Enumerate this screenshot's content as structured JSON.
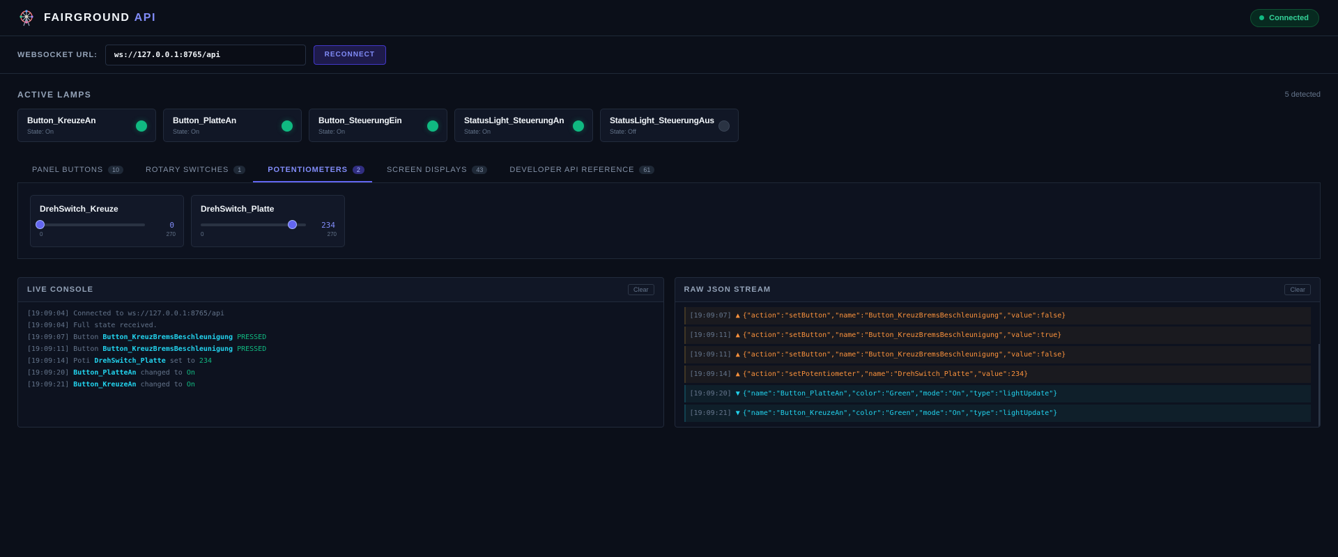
{
  "app": {
    "brand_main": "FAIRGROUND",
    "brand_accent": "API",
    "status": "Connected"
  },
  "connection": {
    "label": "WEBSOCKET URL:",
    "url": "ws://127.0.0.1:8765/api",
    "reconnect_label": "RECONNECT"
  },
  "lamps": {
    "title": "ACTIVE LAMPS",
    "detected": "5 detected",
    "items": [
      {
        "name": "Button_KreuzeAn",
        "state": "State: On",
        "on": true
      },
      {
        "name": "Button_PlatteAn",
        "state": "State: On",
        "on": true
      },
      {
        "name": "Button_SteuerungEin",
        "state": "State: On",
        "on": true
      },
      {
        "name": "StatusLight_SteuerungAn",
        "state": "State: On",
        "on": true
      },
      {
        "name": "StatusLight_SteuerungAus",
        "state": "State: Off",
        "on": false
      }
    ]
  },
  "tabs": [
    {
      "label": "PANEL BUTTONS",
      "count": "10",
      "active": false
    },
    {
      "label": "ROTARY SWITCHES",
      "count": "1",
      "active": false
    },
    {
      "label": "POTENTIOMETERS",
      "count": "2",
      "active": true
    },
    {
      "label": "SCREEN DISPLAYS",
      "count": "43",
      "active": false
    },
    {
      "label": "DEVELOPER API REFERENCE",
      "count": "61",
      "active": false
    }
  ],
  "potentiometers": [
    {
      "name": "DrehSwitch_Kreuze",
      "value": "0",
      "fraction": 0.0,
      "min": "0",
      "max": "270"
    },
    {
      "name": "DrehSwitch_Platte",
      "value": "234",
      "fraction": 0.8667,
      "min": "0",
      "max": "270"
    }
  ],
  "console": {
    "title": "LIVE CONSOLE",
    "clear_label": "Clear",
    "lines": [
      {
        "ts": "[19:09:04]",
        "pre": "Connected to ws://127.0.0.1:8765/api",
        "name": "",
        "mid": "",
        "kw": ""
      },
      {
        "ts": "[19:09:04]",
        "pre": "Full state received.",
        "name": "",
        "mid": "",
        "kw": ""
      },
      {
        "ts": "[19:09:07]",
        "pre": "Button",
        "name": "Button_KreuzBremsBeschleunigung",
        "mid": "",
        "kw": "PRESSED"
      },
      {
        "ts": "[19:09:11]",
        "pre": "Button",
        "name": "Button_KreuzBremsBeschleunigung",
        "mid": "",
        "kw": "PRESSED"
      },
      {
        "ts": "[19:09:14]",
        "pre": "Poti",
        "name": "DrehSwitch_Platte",
        "mid": "set to",
        "kw": "234"
      },
      {
        "ts": "[19:09:20]",
        "pre": "",
        "name": "Button_PlatteAn",
        "mid": "changed to",
        "kw": "On"
      },
      {
        "ts": "[19:09:21]",
        "pre": "",
        "name": "Button_KreuzeAn",
        "mid": "changed to",
        "kw": "On"
      }
    ]
  },
  "json_stream": {
    "title": "RAW JSON STREAM",
    "clear_label": "Clear",
    "entries": [
      {
        "ts": "[19:09:07]",
        "dir": "out",
        "arrow": "▲",
        "text": "{\"action\":\"setButton\",\"name\":\"Button_KreuzBremsBeschleunigung\",\"value\":false}"
      },
      {
        "ts": "[19:09:11]",
        "dir": "out",
        "arrow": "▲",
        "text": "{\"action\":\"setButton\",\"name\":\"Button_KreuzBremsBeschleunigung\",\"value\":true}"
      },
      {
        "ts": "[19:09:11]",
        "dir": "out",
        "arrow": "▲",
        "text": "{\"action\":\"setButton\",\"name\":\"Button_KreuzBremsBeschleunigung\",\"value\":false}"
      },
      {
        "ts": "[19:09:14]",
        "dir": "out",
        "arrow": "▲",
        "text": "{\"action\":\"setPotentiometer\",\"name\":\"DrehSwitch_Platte\",\"value\":234}"
      },
      {
        "ts": "[19:09:20]",
        "dir": "in",
        "arrow": "▼",
        "text": "{\"name\":\"Button_PlatteAn\",\"color\":\"Green\",\"mode\":\"On\",\"type\":\"lightUpdate\"}"
      },
      {
        "ts": "[19:09:21]",
        "dir": "in",
        "arrow": "▼",
        "text": "{\"name\":\"Button_KreuzeAn\",\"color\":\"Green\",\"mode\":\"On\",\"type\":\"lightUpdate\"}"
      }
    ]
  },
  "colors": {
    "background": "#0b0f19",
    "accent": "#6366f1",
    "on": "#10b981",
    "outgoing": "#fb923c",
    "incoming": "#22d3ee"
  },
  "icons": {
    "logo": "ferris-wheel-icon"
  }
}
